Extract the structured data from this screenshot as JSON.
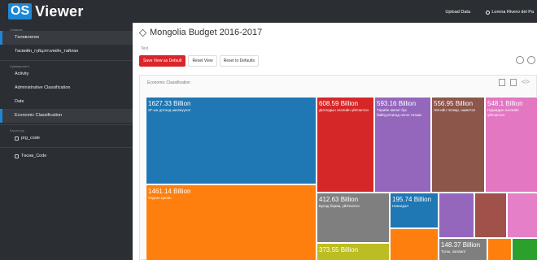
{
  "app": {
    "logo_badge": "OS",
    "logo_text": "Viewer"
  },
  "topbar": {
    "upload": "Upload Data",
    "user": "Lorena Rivero del Pa"
  },
  "sidebar": {
    "section1": "Хэмжээс",
    "items": [
      {
        "label": "Төлөвлөгөө",
        "active": true
      },
      {
        "label": "Тасвийн_гүйцэтгэлийн_тайлан",
        "active": false
      }
    ],
    "section2": "Хуваарилалт",
    "items2": [
      {
        "label": "Activity",
        "active": false
      },
      {
        "label": "Administrative Classification",
        "active": false
      },
      {
        "label": "Date",
        "active": false
      },
      {
        "label": "Economic Classification",
        "active": true
      }
    ],
    "section3": "Шүүлтүүр",
    "items3": [
      {
        "label": "prg_code",
        "icon": "checkbox-icon"
      },
      {
        "label": "Төсөв_Code",
        "icon": "checkbox-icon"
      }
    ]
  },
  "main": {
    "title": "Mongolia Budget 2016-2017",
    "subtitle": "Test",
    "buttons": {
      "save": "Save View as Default",
      "reset": "Reset View",
      "reset_defaults": "Reset to Defaults"
    },
    "panel_title": "Economic Classification"
  },
  "chart_data": {
    "type": "treemap",
    "values": [
      {
        "value": "1627.33 Billion",
        "label": "ЗГ-ын дотоод шилжүүлэг",
        "color": "#1f77b4"
      },
      {
        "value": "1461.14 Billion",
        "label": "Үндсэн цалин",
        "color": "#ff7f0e"
      },
      {
        "value": "608.59 Billion",
        "label": "Дотоодын зээлийн үйлчилгээ",
        "color": "#d62728"
      },
      {
        "value": "593.16 Billion",
        "label": "Төрийн өмчит бус байгууллагад олгох татаас",
        "color": "#9467bd"
      },
      {
        "value": "556.95 Billion",
        "label": "НӨ-ийн татвар, шимтгэл",
        "color": "#8c564b"
      },
      {
        "value": "548.1 Billion",
        "label": "Гадаадын зээлийн үйлчилгээ",
        "color": "#e377c2"
      },
      {
        "value": "412.63 Billion",
        "label": "Бусад бараа, үйлчилгээ",
        "color": "#7f7f7f"
      },
      {
        "value": "195.74 Billion",
        "label": "Нэмэгдэл",
        "color": "#1f77b4"
      },
      {
        "value": "373.55 Billion",
        "label": "",
        "color": "#bcbd22"
      },
      {
        "value": "148.37 Billion",
        "label": "Түлш, халаалт",
        "color": "#7f7f7f"
      }
    ]
  }
}
